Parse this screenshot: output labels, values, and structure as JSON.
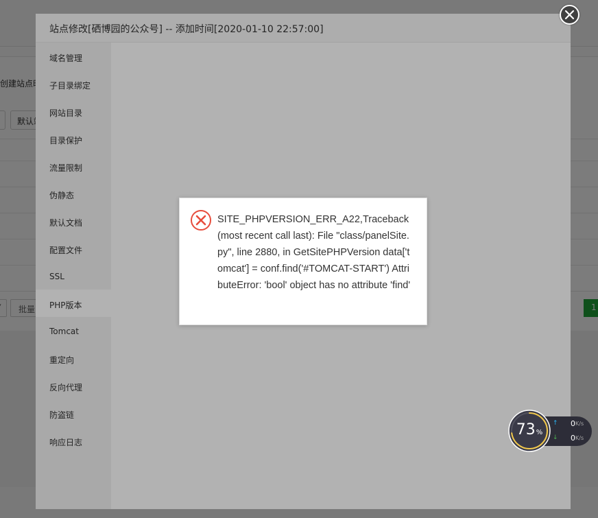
{
  "background": {
    "create_site_partial": "创建站点时",
    "default_partial": "默认站",
    "batch_partial": "批量",
    "select_arrow": "▾",
    "page_number": "1"
  },
  "dialog": {
    "title": "站点修改[硒博园的公众号] -- 添加时间[2020-01-10 22:57:00]",
    "close_icon": "close-circle-icon",
    "menu": [
      {
        "label": "域名管理"
      },
      {
        "label": "子目录绑定"
      },
      {
        "label": "网站目录"
      },
      {
        "label": "目录保护"
      },
      {
        "label": "流量限制"
      },
      {
        "label": "伪静态"
      },
      {
        "label": "默认文档"
      },
      {
        "label": "配置文件"
      },
      {
        "label": "SSL"
      },
      {
        "label": "PHP版本"
      },
      {
        "label": "Tomcat"
      },
      {
        "label": "重定向"
      },
      {
        "label": "反向代理"
      },
      {
        "label": "防盗链"
      },
      {
        "label": "响应日志"
      }
    ],
    "active_item": "PHP版本"
  },
  "error_message": {
    "icon": "error-x-circle-icon",
    "icon_color": "#e74c3c",
    "text": "SITE_PHPVERSION_ERR_A22,Traceback (most recent call last): File \"class/panelSite.py\", line 2880, in GetSitePHPVersion data['tomcat'] = conf.find('#TOMCAT-START') AttributeError: 'bool' object has no attribute 'find'"
  },
  "monitor": {
    "cpu_value": "73",
    "cpu_unit": "%",
    "cpu_fraction": 0.73,
    "upload_value": "0",
    "download_value": "0",
    "speed_unit": "K/s",
    "upload_icon": "arrow-up-icon",
    "download_icon": "arrow-down-icon",
    "upload_color": "#29b6f6",
    "download_color": "#4caf50"
  },
  "colors": {
    "accent_green": "#20a53a",
    "error_red": "#e74c3c"
  }
}
